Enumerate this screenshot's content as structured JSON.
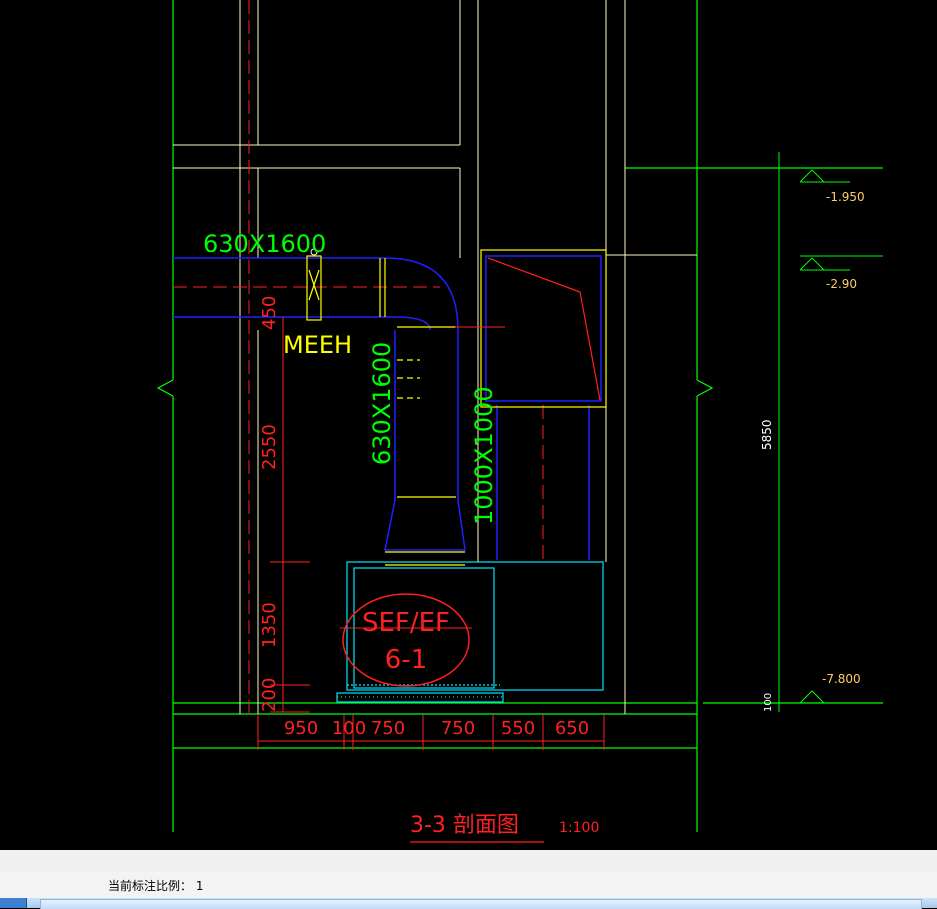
{
  "drawing": {
    "duct_label_horizontal": "630X1600",
    "duct_label_vertical": "630X1600",
    "duct_label_riser": "1000X1000",
    "device_label": "MEEH",
    "equipment_tag_line1": "SEF/EF",
    "equipment_tag_line2": "6-1",
    "section_title": "3-3 剖面图",
    "scale": "1:100"
  },
  "dimensions": {
    "left_vertical": [
      "450",
      "2550",
      "1350",
      "200"
    ],
    "bottom_horizontal": [
      "950",
      "100",
      "750",
      "750",
      "550",
      "650"
    ],
    "right_total": "5850",
    "right_bottom": "100"
  },
  "levels": [
    "-1.950",
    "-2.90",
    "-7.800"
  ],
  "status": {
    "text": "当前标注比例： 1"
  },
  "colors": {
    "background": "#000000",
    "green": "#00ff00",
    "red": "#ff0000",
    "yellow": "#ffff00",
    "blue": "#0000ff",
    "cyan": "#00ffff",
    "white": "#ffffff"
  }
}
